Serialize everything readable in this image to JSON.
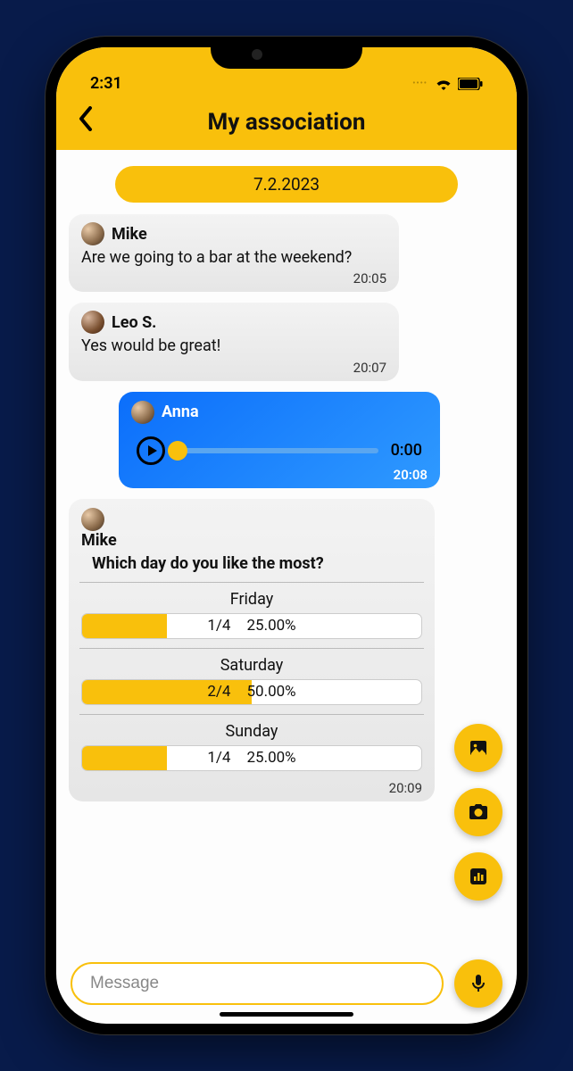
{
  "status": {
    "time": "2:31"
  },
  "header": {
    "title": "My association"
  },
  "date_pill": "7.2.2023",
  "messages": {
    "mike1": {
      "sender": "Mike",
      "text": "Are we going to a bar at the weekend?",
      "time": "20:05"
    },
    "leo": {
      "sender": "Leo S.",
      "text": "Yes would be great!",
      "time": "20:07"
    },
    "anna": {
      "sender": "Anna",
      "duration": "0:00",
      "time": "20:08"
    },
    "poll": {
      "sender": "Mike",
      "question": "Which day do you like the most?",
      "time": "20:09",
      "options": {
        "friday": {
          "label": "Friday",
          "count": "1/4",
          "percent": "25.00%",
          "width": "25%"
        },
        "saturday": {
          "label": "Saturday",
          "count": "2/4",
          "percent": "50.00%",
          "width": "50%"
        },
        "sunday": {
          "label": "Sunday",
          "count": "1/4",
          "percent": "25.00%",
          "width": "25%"
        }
      }
    }
  },
  "input": {
    "placeholder": "Message"
  }
}
